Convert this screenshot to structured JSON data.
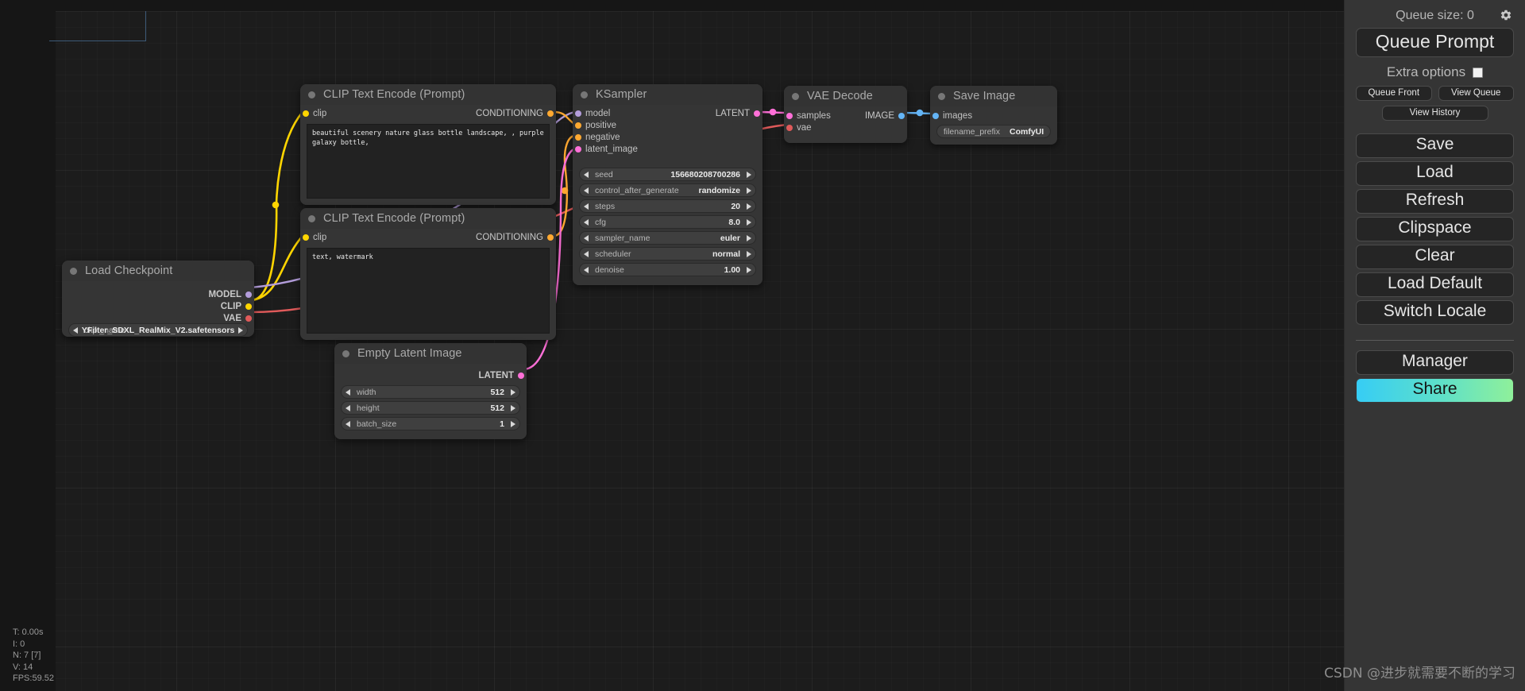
{
  "app": {
    "name": "ComfyUI"
  },
  "nodes": {
    "clip_positive": {
      "title": "CLIP Text Encode (Prompt)",
      "input": "clip",
      "output": "CONDITIONING",
      "text": "beautiful scenery nature glass bottle landscape, , purple galaxy bottle,"
    },
    "clip_negative": {
      "title": "CLIP Text Encode (Prompt)",
      "input": "clip",
      "output": "CONDITIONING",
      "text": "text, watermark"
    },
    "ksampler": {
      "title": "KSampler",
      "inputs": [
        "model",
        "positive",
        "negative",
        "latent_image"
      ],
      "output": "LATENT",
      "widgets": [
        {
          "label": "seed",
          "value": "156680208700286"
        },
        {
          "label": "control_after_generate",
          "value": "randomize"
        },
        {
          "label": "steps",
          "value": "20"
        },
        {
          "label": "cfg",
          "value": "8.0"
        },
        {
          "label": "sampler_name",
          "value": "euler"
        },
        {
          "label": "scheduler",
          "value": "normal"
        },
        {
          "label": "denoise",
          "value": "1.00"
        }
      ]
    },
    "vae_decode": {
      "title": "VAE Decode",
      "inputs": [
        "samples",
        "vae"
      ],
      "output": "IMAGE"
    },
    "save_image": {
      "title": "Save Image",
      "input": "images",
      "widget": {
        "label": "filename_prefix",
        "value": "ComfyUI"
      }
    },
    "load_checkpoint": {
      "title": "Load Checkpoint",
      "outputs": [
        "MODEL",
        "CLIP",
        "VAE"
      ],
      "widget": {
        "label": "ckpt_name",
        "value": "YFilter_SDXL_RealMix_V2.safetensors"
      }
    },
    "empty_latent": {
      "title": "Empty Latent Image",
      "output": "LATENT",
      "widgets": [
        {
          "label": "width",
          "value": "512"
        },
        {
          "label": "height",
          "value": "512"
        },
        {
          "label": "batch_size",
          "value": "1"
        }
      ]
    }
  },
  "sidebar": {
    "queue_size_label": "Queue size: 0",
    "queue_prompt": "Queue Prompt",
    "extra_options": "Extra options",
    "queue_front": "Queue Front",
    "view_queue": "View Queue",
    "view_history": "View History",
    "save": "Save",
    "load": "Load",
    "refresh": "Refresh",
    "clipspace": "Clipspace",
    "clear": "Clear",
    "load_default": "Load Default",
    "switch_locale": "Switch Locale",
    "manager": "Manager",
    "share": "Share"
  },
  "stats": {
    "time": "T: 0.00s",
    "iterations": "I: 0",
    "nodes": "N: 7 [7]",
    "vertices": "V: 14",
    "fps": "FPS:59.52"
  },
  "watermark": "CSDN @进步就需要不断的学习",
  "colors": {
    "model_port": "#b39ddb",
    "clip_port": "#ffd500",
    "vae_port": "#ff6e6e",
    "conditioning_port": "#ffa931",
    "latent_port": "#ff70d8",
    "image_port": "#64b5f6",
    "share_gradient_start": "#36cdf5",
    "share_gradient_end": "#8ff09a",
    "node_bg": "#353535",
    "canvas_bg": "#1c1c1c"
  }
}
